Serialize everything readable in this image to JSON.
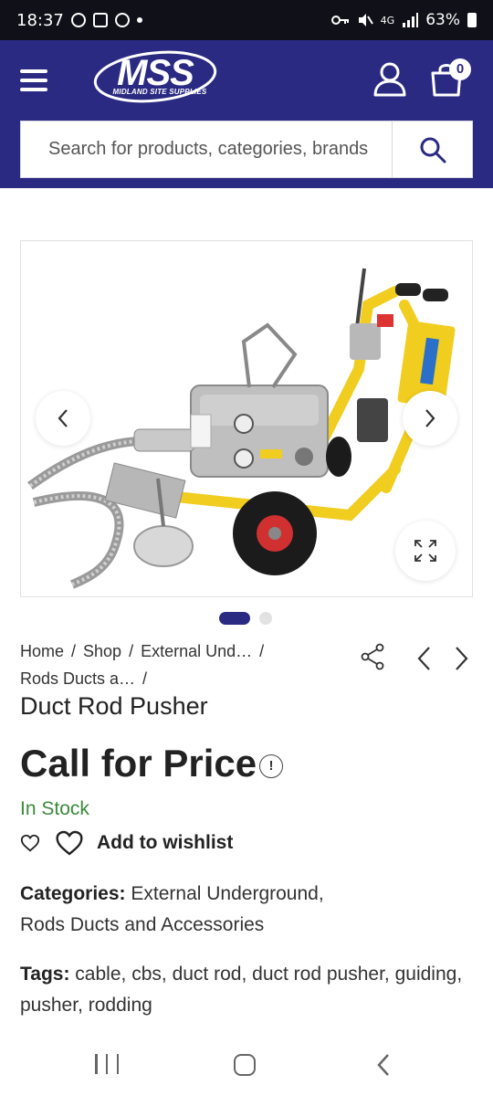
{
  "status_bar": {
    "time": "18:37",
    "network": "4G",
    "battery": "63%"
  },
  "header": {
    "logo_text": "MSS",
    "logo_subtext": "MIDLAND SITE SUPPLIES",
    "cart_count": "0",
    "search": {
      "placeholder": "Search for products, categories, brands"
    },
    "brand_color": "#2b2a83"
  },
  "gallery": {
    "image": "duct-rod-pusher-photo",
    "slide_count": 2,
    "active_slide": 1
  },
  "breadcrumb": {
    "items": [
      "Home",
      "Shop",
      "External Und…",
      "Rods Ducts a…"
    ],
    "separator": "/"
  },
  "product": {
    "title": "Duct Rod Pusher",
    "price": "Call for Price",
    "price_info_icon": "!",
    "stock": "In Stock",
    "stock_color": "#3a8a3a",
    "wishlist_label": "Add to wishlist"
  },
  "meta": {
    "categories_label": "Categories:",
    "categories": [
      "External Underground",
      "Rods Ducts and Accessories"
    ],
    "tags_label": "Tags:",
    "tags": [
      "cable",
      "cbs",
      "duct rod",
      "duct rod pusher",
      "guiding",
      "pusher",
      "rodding"
    ],
    "comma": ","
  }
}
